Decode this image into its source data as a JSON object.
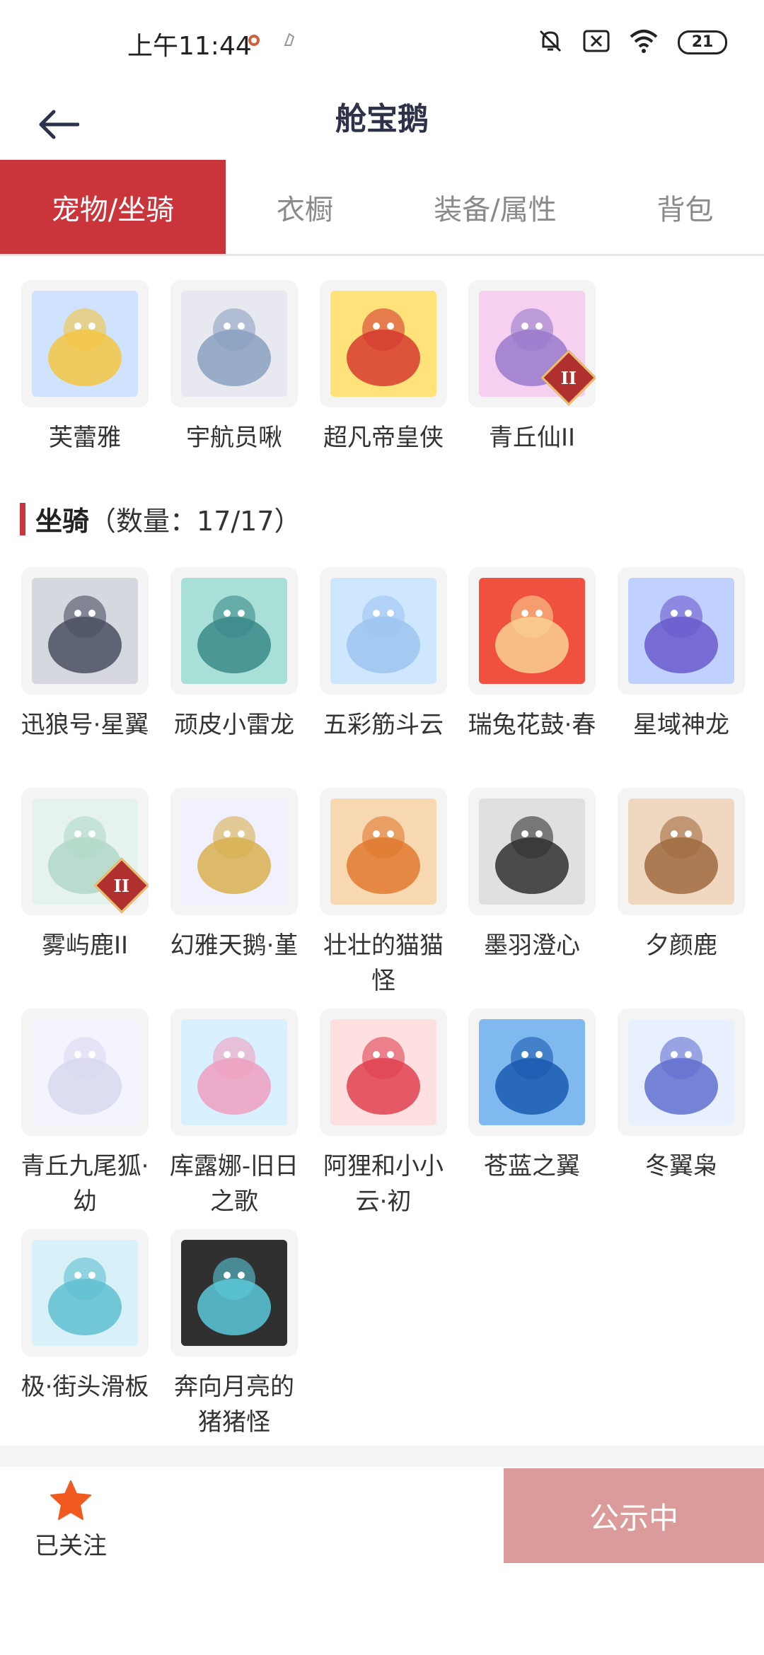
{
  "status_bar": {
    "time": "上午11:44",
    "battery": "21",
    "wifi_sub": "6"
  },
  "header": {
    "title": "舱宝鹅"
  },
  "tabs": [
    {
      "label": "宠物/坐骑",
      "active": true
    },
    {
      "label": "衣橱",
      "active": false
    },
    {
      "label": "装备/属性",
      "active": false
    },
    {
      "label": "背包",
      "active": false
    }
  ],
  "pets": [
    {
      "name": "芙蕾雅",
      "badge": ""
    },
    {
      "name": "宇航员啾",
      "badge": ""
    },
    {
      "name": "超凡帝皇侠",
      "badge": ""
    },
    {
      "name": "青丘仙II",
      "badge": "II"
    }
  ],
  "mounts_section": {
    "title": "坐骑",
    "count": "（数量：17/17）"
  },
  "mounts": [
    {
      "name": "迅狼号·星翼",
      "badge": ""
    },
    {
      "name": "顽皮小雷龙",
      "badge": ""
    },
    {
      "name": "五彩筋斗云",
      "badge": ""
    },
    {
      "name": "瑞兔花鼓·春",
      "badge": ""
    },
    {
      "name": "星域神龙",
      "badge": ""
    },
    {
      "name": "雾屿鹿II",
      "badge": "II"
    },
    {
      "name": "幻雅天鹅·堇",
      "badge": ""
    },
    {
      "name": "壮壮的猫猫怪",
      "badge": ""
    },
    {
      "name": "墨羽澄心",
      "badge": ""
    },
    {
      "name": "夕颜鹿",
      "badge": ""
    },
    {
      "name": "青丘九尾狐·幼",
      "badge": ""
    },
    {
      "name": "库露娜-旧日之歌",
      "badge": ""
    },
    {
      "name": "阿狸和小小云·初",
      "badge": ""
    },
    {
      "name": "苍蓝之翼",
      "badge": ""
    },
    {
      "name": "冬翼枭",
      "badge": ""
    },
    {
      "name": "极·街头滑板",
      "badge": ""
    },
    {
      "name": "奔向月亮的猪猪怪",
      "badge": ""
    }
  ],
  "bottom_bar": {
    "follow_label": "已关注",
    "public_button": "公示中"
  },
  "colors": {
    "accent": "#c9353a",
    "public_button": "#dc9b9b",
    "star": "#f05a1e"
  }
}
